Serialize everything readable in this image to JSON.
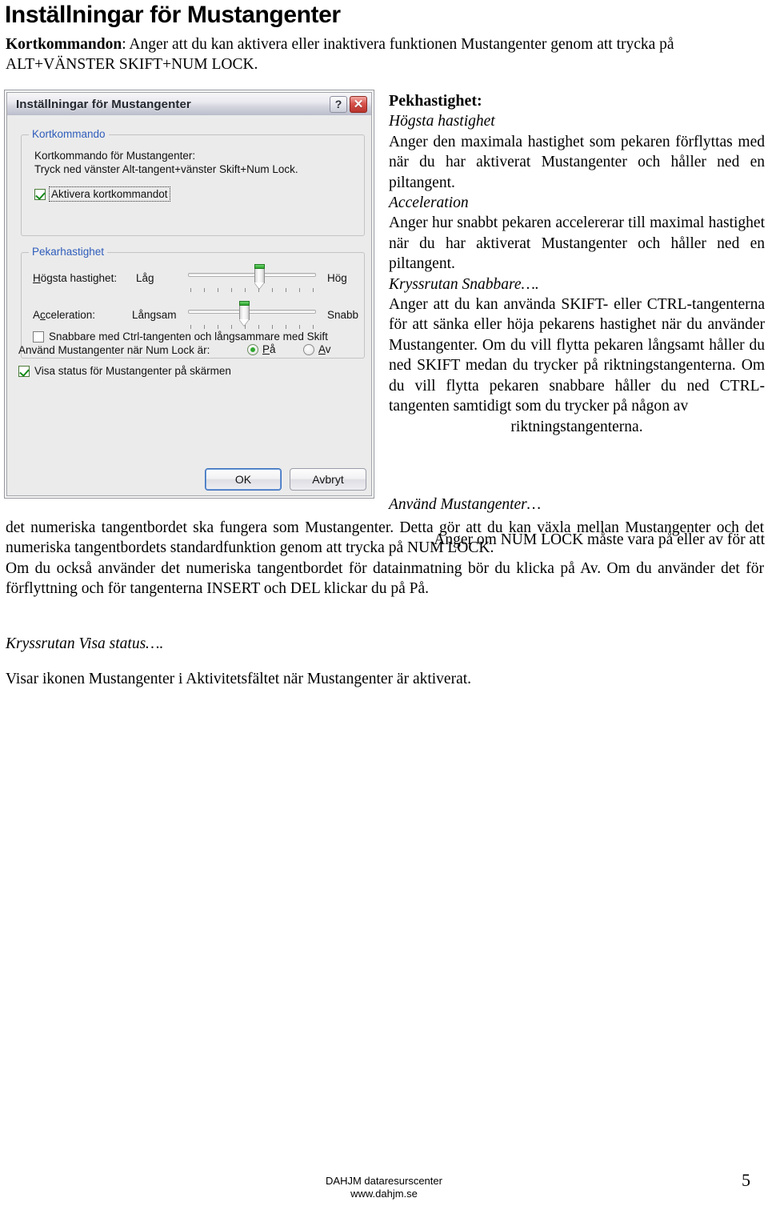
{
  "document": {
    "title": "Inställningar för Mustangenter",
    "intro_label": "Kortkommandon",
    "intro_text": ": Anger att du kan aktivera eller inaktivera funktionen Mustangenter genom att trycka på ALT+VÄNSTER SKIFT+NUM LOCK.",
    "page_number": "5",
    "footer_line1": "DAHJM dataresurscenter",
    "footer_line2": "www.dahjm.se"
  },
  "dialog": {
    "title": "Inställningar för Mustangenter",
    "help_button": "?",
    "close_button": "✕",
    "group_shortcut": {
      "legend": "Kortkommando",
      "line1": "Kortkommando för Mustangenter:",
      "line2": "Tryck ned vänster Alt-tangent+vänster Skift+Num Lock.",
      "checkbox_label": "Aktivera kortkommandot",
      "checkbox_checked": "true"
    },
    "group_pointer": {
      "legend": "Pekarhastighet",
      "max_speed_label": "Högsta hastighet:",
      "max_speed_min": "Låg",
      "max_speed_max": "Hög",
      "max_speed_value": "62",
      "accel_label": "Acceleration:",
      "accel_min": "Långsam",
      "accel_max": "Snabb",
      "accel_value": "55",
      "ticks": 10,
      "checkbox_label": "Snabbare med Ctrl-tangenten och långsammare med Skift",
      "checkbox_checked": "false"
    },
    "numlock": {
      "label": "Använd Mustangenter när Num Lock är:",
      "option_on": "På",
      "option_off": "Av",
      "selected": "På"
    },
    "show_status": {
      "label": "Visa status för Mustangenter på skärmen",
      "checked": "true"
    },
    "buttons": {
      "ok": "OK",
      "cancel": "Avbryt"
    }
  },
  "right_column": {
    "heading": "Pekhastighet:",
    "sub1_heading": "Högsta hastighet",
    "sub1_body": "Anger den maximala hastighet som pekaren förflyttas med när du har aktiverat Mustangenter och håller ned en piltangent.",
    "sub2_heading": "Acceleration",
    "sub2_body": "Anger hur snabbt pekaren accelererar till maximal hastighet när du har aktiverat Mustangenter och håller ned en piltangent.",
    "sub3_heading": "Kryssrutan Snabbare….",
    "sub3_body": "Anger att du kan använda SKIFT- eller CTRL-tangenterna för att sänka eller höja pekarens hastighet när du använder Mustangenter. Om du vill flytta pekaren långsamt håller du ned SKIFT medan du trycker på riktningstangenterna. Om du vill flytta pekaren snabbare håller du ned CTRL-tangenten samtidigt som du trycker på någon av",
    "sub3_body_lastline": "riktningstangenterna."
  },
  "anvand_block": {
    "heading": "Använd Mustangenter…",
    "intro": "Anger om NUM LOCK måste vara på eller av för att"
  },
  "wide_block": {
    "para1": "det numeriska tangentbordet ska fungera som Mustangenter. Detta gör att du kan växla mellan Mustangenter och det numeriska tangentbordets standardfunktion genom att trycka på NUM LOCK.",
    "para2": "Om du också använder det numeriska tangentbordet för datainmatning bör du klicka på Av. Om du använder det för förflyttning och för tangenterna INSERT och DEL klickar du på På."
  },
  "kryss_block": {
    "heading": "Kryssrutan Visa status….",
    "body": "Visar ikonen Mustangenter i Aktivitetsfältet när Mustangenter är aktiverat."
  },
  "colors": {
    "legend_blue": "#2f5dbb",
    "check_green": "#128a18",
    "close_red": "#d8534c",
    "dialog_bg": "#ebebeb"
  }
}
